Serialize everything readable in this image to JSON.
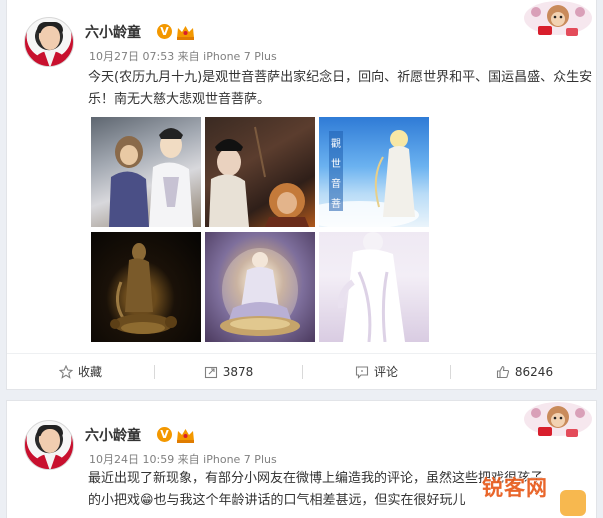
{
  "posts": [
    {
      "author": "六小龄童",
      "verified_badge": "V",
      "meta": "10月27日 07:53 来自 iPhone 7 Plus",
      "text": "今天(农历九月十九)是观世音菩萨出家纪念日，回向、祈愿世界和平、国运昌盛、众生安乐！南无大慈大悲观世音菩萨。",
      "images": [
        "photo-1",
        "photo-2",
        "photo-3",
        "photo-4",
        "photo-5",
        "photo-6"
      ],
      "actions": {
        "favorite": "收藏",
        "repost_count": "3878",
        "comment": "评论",
        "like_count": "86246"
      }
    },
    {
      "author": "六小龄童",
      "verified_badge": "V",
      "meta": "10月24日 10:59 来自 iPhone 7 Plus",
      "text_line1": "最近出现了新现象，有部分小网友在微博上编造我的评论，虽然这些把戏很孩子",
      "text_line2": "的小把戏😁也与我这个年龄讲话的口气相差甚远，但实在很好玩儿"
    }
  ],
  "colors": {
    "accent_orange": "#f39800",
    "link_text": "#333333",
    "meta_gray": "#808080",
    "watermark": "#e85a1a"
  },
  "watermark": "锐客网",
  "icons": [
    "star-icon",
    "repost-icon",
    "comment-icon",
    "like-icon",
    "crown-icon",
    "monkey-decor-icon"
  ]
}
